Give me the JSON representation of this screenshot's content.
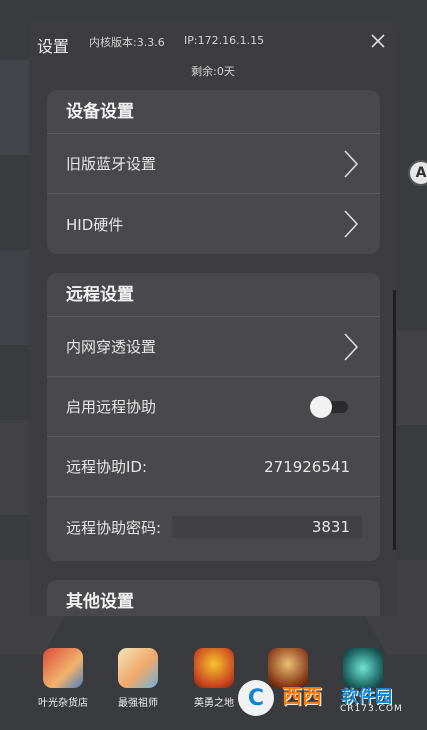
{
  "dialog": {
    "title": "设置",
    "version": "内核版本:3.3.6",
    "ip": "IP:172.16.1.15",
    "remaining": "剩余:0天"
  },
  "sections": {
    "device": {
      "title": "设备设置",
      "bluetooth_label": "旧版蓝牙设置",
      "hid_label": "HID硬件"
    },
    "remote": {
      "title": "远程设置",
      "intranet_label": "内网穿透设置",
      "enable_label": "启用远程协助",
      "enable_state": false,
      "id_label": "远程协助ID:",
      "id_value": "271926541",
      "password_label": "远程协助密码:",
      "password_value": "3831"
    },
    "other": {
      "title": "其他设置"
    }
  },
  "dock": [
    {
      "label": "叶光杂货店",
      "icon": "grocery-app-icon"
    },
    {
      "label": "最强祖师",
      "icon": "anime-app-icon"
    },
    {
      "label": "英勇之地",
      "icon": "hero-game-icon"
    },
    {
      "label": "",
      "icon": "viking-game-icon"
    },
    {
      "label": "",
      "icon": "warcraft-app-icon"
    }
  ],
  "watermark": {
    "brand": "西西",
    "suffix": "软件园",
    "url": "CR173.COM"
  },
  "colors": {
    "dialog_bg": "#3d3d3f",
    "card_bg": "#49494b",
    "page_bg": "#3a3b3f"
  }
}
